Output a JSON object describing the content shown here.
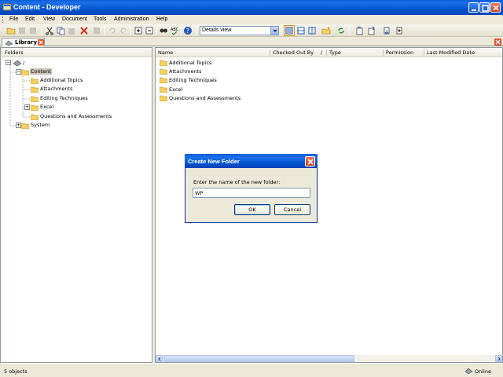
{
  "window": {
    "title": "Content - Developer"
  },
  "menu": [
    {
      "label": "File",
      "name": "menu-file"
    },
    {
      "label": "Edit",
      "name": "menu-edit"
    },
    {
      "label": "View",
      "name": "menu-view"
    },
    {
      "label": "Document",
      "name": "menu-document"
    },
    {
      "label": "Tools",
      "name": "menu-tools"
    },
    {
      "label": "Administration",
      "name": "menu-administration"
    },
    {
      "label": "Help",
      "name": "menu-help"
    }
  ],
  "toolbar": {
    "view_select": "Details view"
  },
  "tabs": {
    "library": "Library"
  },
  "left_pane": {
    "header": "Folders",
    "tree": {
      "root": "/",
      "content": "Content",
      "children": [
        "Additional Topics",
        "Attachments",
        "Editing Techniques",
        "Excel",
        "Questions and Assessments"
      ],
      "system": "System"
    }
  },
  "right_pane": {
    "columns": [
      "Name",
      "Checked Out By",
      "/",
      "Type",
      "Permission",
      "Last Modified Date"
    ],
    "items": [
      "Additional Topics",
      "Attachments",
      "Editing Techniques",
      "Excel",
      "Questions and Assessments"
    ]
  },
  "status": {
    "left": "5 objects",
    "right": "Online"
  },
  "dialog": {
    "title": "Create New Folder",
    "prompt": "Enter the name of the new folder:",
    "input_value": "WP",
    "ok_label": "OK",
    "cancel_label": "Cancel"
  },
  "colors": {
    "titlebar": "#0454d0",
    "folder": "#f5d063",
    "selection": "#c6c3b6",
    "close": "#e0502c"
  }
}
